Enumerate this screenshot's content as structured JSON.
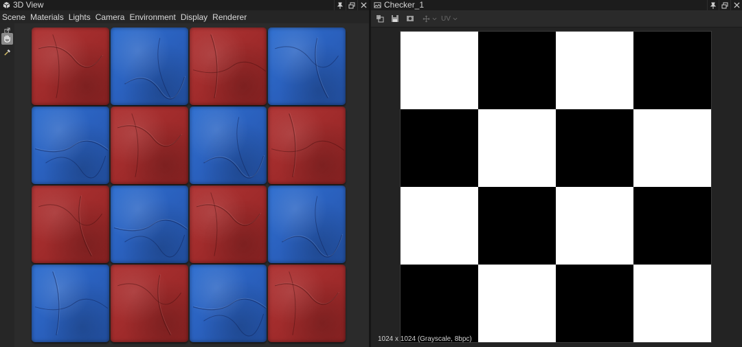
{
  "view3d": {
    "title": "3D View",
    "menu": [
      "Scene",
      "Materials",
      "Lights",
      "Camera",
      "Environment",
      "Display",
      "Renderer"
    ],
    "tools": [
      "export-icon",
      "paint-hand-icon",
      "picker-icon"
    ],
    "clay_rows": [
      [
        "red",
        "blue",
        "red",
        "blue"
      ],
      [
        "blue",
        "red",
        "blue",
        "red"
      ],
      [
        "red",
        "blue",
        "red",
        "blue"
      ],
      [
        "blue",
        "red",
        "blue",
        "red"
      ]
    ],
    "colors": {
      "clay_red": "#a02b2b",
      "clay_blue": "#2a60bd"
    }
  },
  "texture": {
    "title": "Checker_1",
    "uv_label": "UV",
    "info": "1024 x 1024 (Grayscale, 8bpc)",
    "checker_rows": [
      [
        "white",
        "black",
        "white",
        "black"
      ],
      [
        "black",
        "white",
        "black",
        "white"
      ],
      [
        "white",
        "black",
        "white",
        "black"
      ],
      [
        "black",
        "white",
        "black",
        "white"
      ]
    ]
  }
}
